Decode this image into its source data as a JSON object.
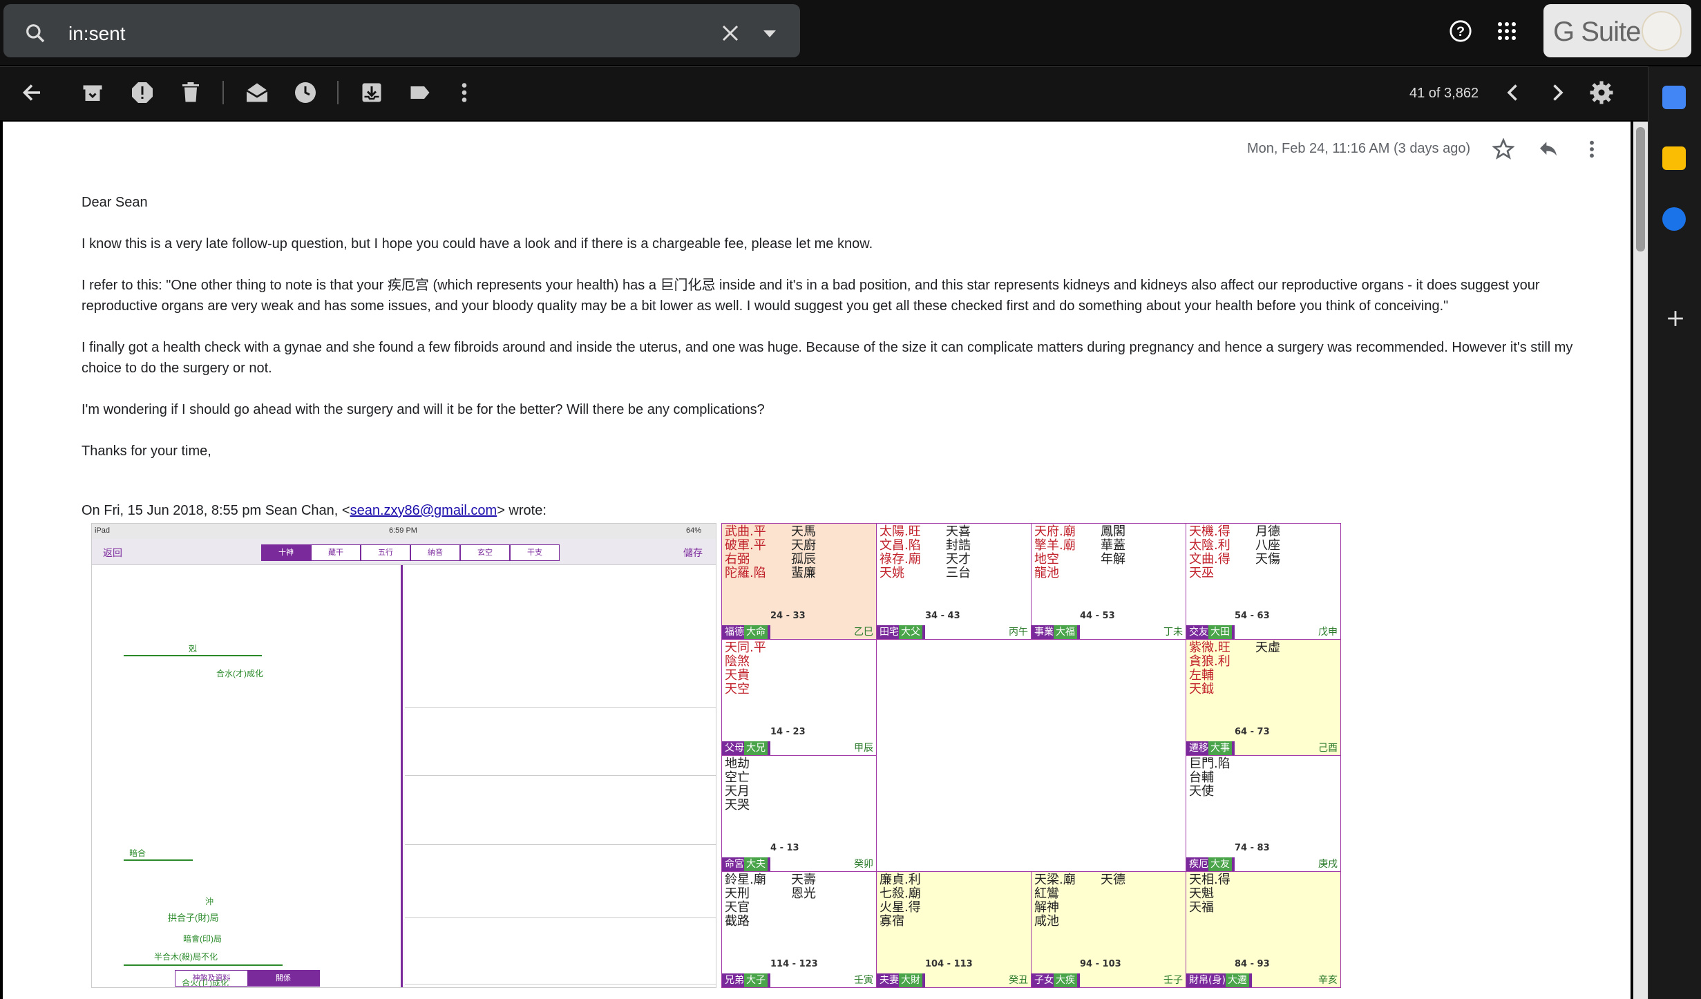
{
  "search": {
    "query": "in:sent"
  },
  "header": {
    "brand": "G Suite"
  },
  "toolbar": {
    "count": "41 of 3,862"
  },
  "email": {
    "date": "Mon, Feb 24, 11:16 AM (3 days ago)",
    "greeting": "Dear Sean",
    "p1": "I know this is a very late follow-up question, but I hope you could have a look and if there is a chargeable fee, please let me know.",
    "p2": "I refer to this: \"One other thing to note is that your 疾厄宫 (which represents your health) has a 巨门化忌 inside and it's in a bad position, and this star represents kidneys and kidneys also affect our reproductive organs - it does suggest your reproductive organs are very weak and has some issues, and your bloody quality may be a bit lower as well. I would suggest you get all these checked first and do something about your health before you think of conceiving.\"",
    "p3": "I finally got a health check with a gynae and she found a few fibroids around and inside the uterus, and one was huge. Because of the size it can complicate matters during pregnancy and hence a surgery was recommended. However it's still my choice to do the surgery or not.",
    "p4": "I'm wondering if I should go ahead with the surgery and will it be for the better? Will there be any complications?",
    "p5": "Thanks for your time,",
    "quote_prefix": "On Fri, 15 Jun 2018, 8:55 pm Sean Chan, <",
    "quote_email": "sean.zxy86@gmail.com",
    "quote_suffix": "> wrote:"
  },
  "ipad": {
    "status_left": "iPad",
    "status_time": "6:59 PM",
    "status_right": "64%",
    "back": "返回",
    "save": "儲存",
    "tabs": [
      "十神",
      "藏干",
      "五行",
      "納音",
      "玄空",
      "干支"
    ],
    "bottom_tabs": [
      "神煞及資料",
      "關係"
    ],
    "labels": [
      "剋",
      "暗合",
      "拱合子(財)局",
      "沖",
      "暗會(印)局",
      "半合木(殺)局不化",
      "合火(卩)成化",
      "合水(才)成化"
    ]
  },
  "chart": {
    "cells": [
      {
        "stars": "武曲.平\n破軍.平\n右弼\n陀羅.陷",
        "stars2": "天馬\n天廚\n孤辰\n蜚廉",
        "range": "24 - 33",
        "palace": "福德",
        "sub": "大命",
        "gz": "乙巳"
      },
      {
        "stars": "太陽.旺\n文昌.陷\n祿存.廟\n天姚",
        "stars2": "天喜\n封誥\n天才\n三台",
        "range": "34 - 43",
        "palace": "田宅",
        "sub": "大父",
        "gz": "丙午"
      },
      {
        "stars": "天府.廟\n擎羊.廟\n地空\n龍池",
        "stars2": "鳳閣\n華蓋\n年解",
        "range": "44 - 53",
        "palace": "事業",
        "sub": "大福",
        "gz": "丁未"
      },
      {
        "stars": "天機.得\n太陰.利\n文曲.得\n天巫",
        "stars2": "月德\n八座\n天傷",
        "range": "54 - 63",
        "palace": "交友",
        "sub": "大田",
        "gz": "戊申"
      },
      {
        "stars": "天同.平\n陰煞\n天貴\n天空",
        "stars2": "",
        "range": "14 - 23",
        "palace": "父母",
        "sub": "大兄",
        "gz": "甲辰"
      },
      {
        "stars": "紫微.旺\n貪狼.利\n左輔\n天鉞",
        "stars2": "天虛",
        "range": "64 - 73",
        "palace": "遷移",
        "sub": "大事",
        "gz": "己酉"
      },
      {
        "stars": "地劫\n空亡\n天月\n天哭",
        "stars2": "",
        "range": "4 - 13",
        "palace": "命宮",
        "sub": "大夫",
        "gz": "癸卯"
      },
      {
        "stars": "巨門.陷\n台輔\n天使",
        "stars2": "",
        "range": "74 - 83",
        "palace": "疾厄",
        "sub": "大友",
        "gz": "庚戌"
      },
      {
        "stars": "鈴星.廟\n天刑\n天官\n截路",
        "stars2": "天壽\n恩光",
        "range": "114 - 123",
        "palace": "兄弟",
        "sub": "大子",
        "gz": "壬寅"
      },
      {
        "stars": "廉貞.利\n七殺.廟\n火星.得\n寡宿",
        "stars2": "",
        "range": "104 - 113",
        "palace": "夫妻",
        "sub": "大財",
        "gz": "癸丑"
      },
      {
        "stars": "天梁.廟\n紅鸞\n解神\n咸池",
        "stars2": "天德",
        "range": "94 - 103",
        "palace": "子女",
        "sub": "大疾",
        "gz": "壬子"
      },
      {
        "stars": "天相.得\n天魁\n天福",
        "stars2": "",
        "range": "84 - 93",
        "palace": "財帛(身)",
        "sub": "大遷",
        "gz": "辛亥"
      }
    ]
  },
  "colors": {
    "accent": "#7b2a9c",
    "link": "#1a0dab"
  }
}
